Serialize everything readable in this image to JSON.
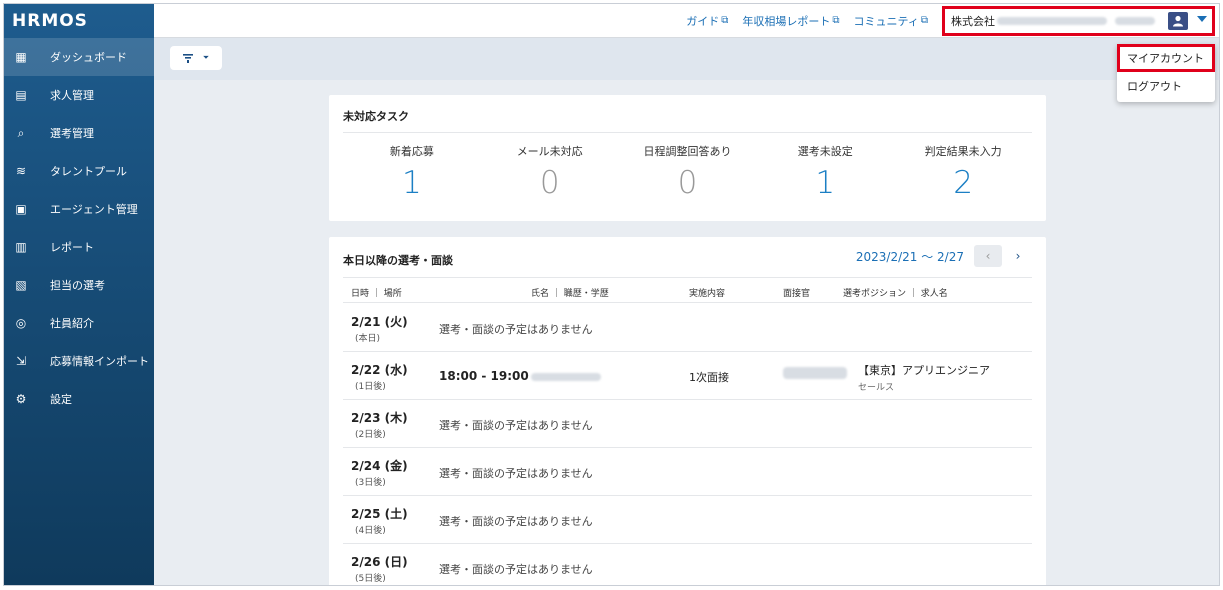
{
  "app": {
    "logo": "HRMOS"
  },
  "sidebar": {
    "items": [
      {
        "label": "ダッシュボード",
        "icon": "dashboard-icon",
        "glyph": "▦",
        "active": true
      },
      {
        "label": "求人管理",
        "icon": "document-icon",
        "glyph": "▤"
      },
      {
        "label": "選考管理",
        "icon": "search-icon",
        "glyph": "⌕"
      },
      {
        "label": "タレントプール",
        "icon": "swimmer-icon",
        "glyph": "≋"
      },
      {
        "label": "エージェント管理",
        "icon": "briefcase-icon",
        "glyph": "▣"
      },
      {
        "label": "レポート",
        "icon": "bar-chart-icon",
        "glyph": "▥"
      },
      {
        "label": "担当の選考",
        "icon": "clipboard-icon",
        "glyph": "▧"
      },
      {
        "label": "社員紹介",
        "icon": "people-icon",
        "glyph": "◎"
      },
      {
        "label": "応募情報インポート",
        "icon": "import-icon",
        "glyph": "⇲"
      },
      {
        "label": "設定",
        "icon": "gear-icon",
        "glyph": "⚙"
      }
    ]
  },
  "header": {
    "links": [
      {
        "label": "ガイド",
        "icon": "external-link-icon"
      },
      {
        "label": "年収相場レポート",
        "icon": "external-link-icon"
      },
      {
        "label": "コミュニティ",
        "icon": "external-link-icon"
      }
    ],
    "company_label": "株式会社",
    "ext_glyph": "⧉"
  },
  "toolbar": {
    "filter_glyph": "⏷"
  },
  "account_menu": {
    "items": [
      {
        "label": "マイアカウント",
        "highlighted": true
      },
      {
        "label": "ログアウト"
      }
    ]
  },
  "tasks": {
    "title": "未対応タスク",
    "items": [
      {
        "label": "新着応募",
        "count": "1",
        "tone": "blue"
      },
      {
        "label": "メール未対応",
        "count": "0",
        "tone": "gray"
      },
      {
        "label": "日程調整回答あり",
        "count": "0",
        "tone": "gray"
      },
      {
        "label": "選考未設定",
        "count": "1",
        "tone": "blue"
      },
      {
        "label": "判定結果未入力",
        "count": "2",
        "tone": "blue"
      }
    ]
  },
  "schedule": {
    "title": "本日以降の選考・面談",
    "range": "2023/2/21 ～ 2/27",
    "prev": "‹",
    "next": "›",
    "columns": {
      "datetime": "日時 ｜ 場所",
      "name": "氏名 ｜ 職歴・学歴",
      "content": "実施内容",
      "interviewer": "面接官",
      "position": "選考ポジション ｜ 求人名"
    },
    "rows": [
      {
        "date": "2/21 (火)",
        "rel": "(本日)",
        "msg": "選考・面談の予定はありません"
      },
      {
        "date": "2/22 (水)",
        "rel": "(1日後)",
        "time": "18:00 - 19:00",
        "kind": "1次面接",
        "position": "【東京】アプリエンジニア",
        "sub": "セールス"
      },
      {
        "date": "2/23 (木)",
        "rel": "(2日後)",
        "msg": "選考・面談の予定はありません"
      },
      {
        "date": "2/24 (金)",
        "rel": "(3日後)",
        "msg": "選考・面談の予定はありません"
      },
      {
        "date": "2/25 (土)",
        "rel": "(4日後)",
        "msg": "選考・面談の予定はありません"
      },
      {
        "date": "2/26 (日)",
        "rel": "(5日後)",
        "msg": "選考・面談の予定はありません"
      }
    ]
  },
  "colors": {
    "accent": "#1b6fb5",
    "highlight": "#e0001b",
    "sidebar": "#1e5c8e"
  }
}
